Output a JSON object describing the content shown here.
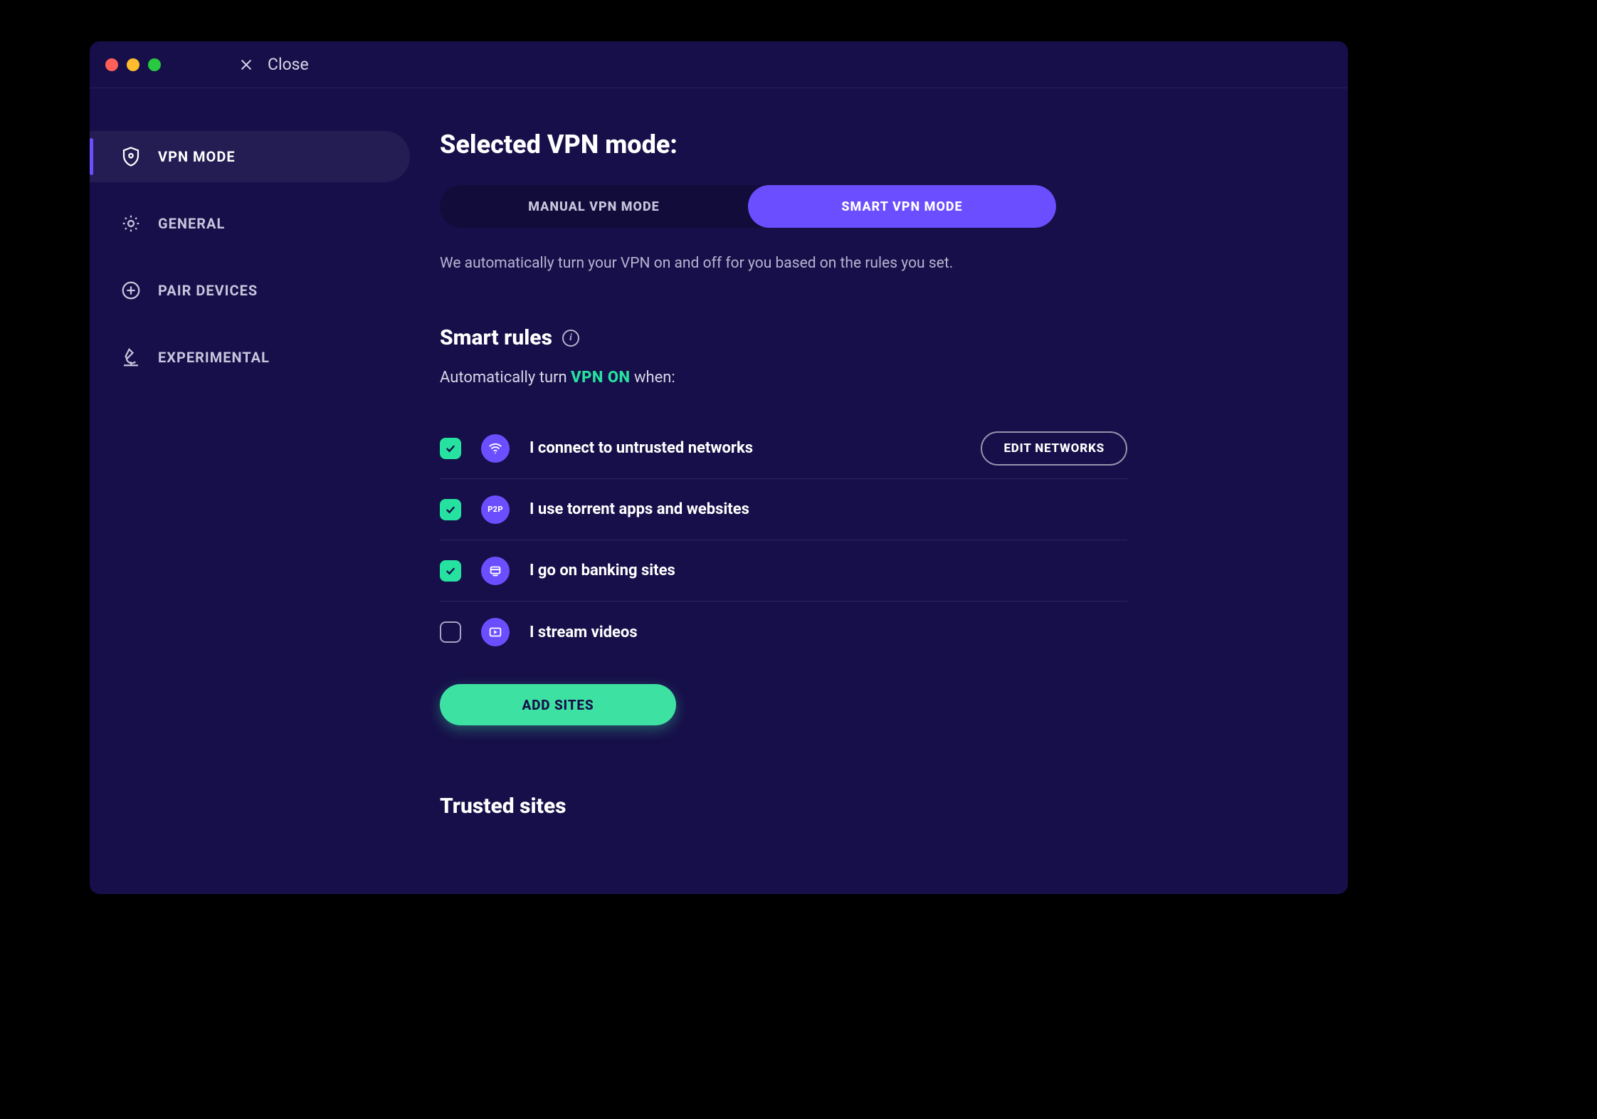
{
  "titlebar": {
    "close_label": "Close"
  },
  "sidebar": {
    "items": [
      {
        "label": "VPN MODE"
      },
      {
        "label": "GENERAL"
      },
      {
        "label": "PAIR DEVICES"
      },
      {
        "label": "EXPERIMENTAL"
      }
    ]
  },
  "content": {
    "heading": "Selected VPN mode:",
    "mode_options": {
      "manual": "MANUAL VPN MODE",
      "smart": "SMART VPN MODE"
    },
    "mode_description": "We automatically turn your VPN on and off for you based on the rules you set.",
    "smart_rules_heading": "Smart rules",
    "rules_prefix": "Automatically turn ",
    "rules_highlight": "VPN ON",
    "rules_suffix": " when:",
    "rules": [
      {
        "label": "I connect to untrusted networks",
        "checked": true,
        "action": "EDIT NETWORKS"
      },
      {
        "label": "I use torrent apps and websites",
        "checked": true
      },
      {
        "label": "I go on banking sites",
        "checked": true
      },
      {
        "label": "I stream videos",
        "checked": false
      }
    ],
    "add_sites_label": "ADD SITES",
    "trusted_heading": "Trusted sites"
  }
}
